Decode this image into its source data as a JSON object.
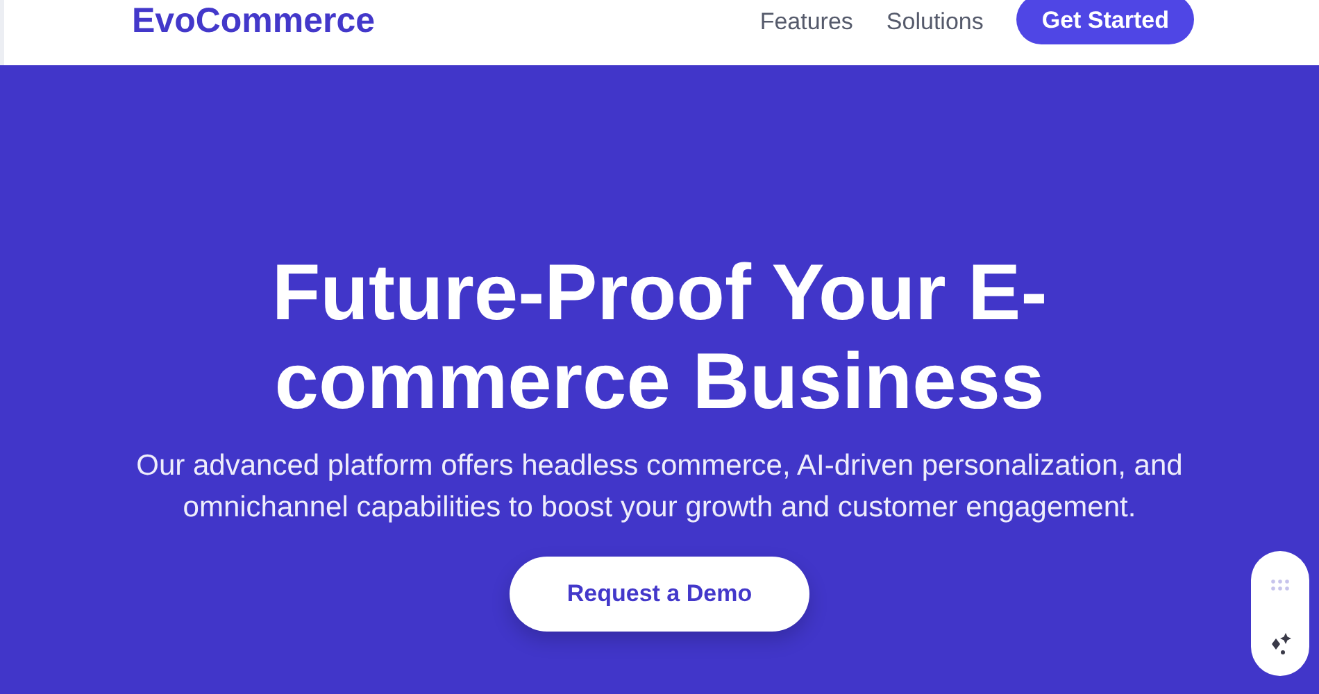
{
  "header": {
    "logo": "EvoCommerce",
    "nav": [
      {
        "label": "Features"
      },
      {
        "label": "Solutions"
      }
    ],
    "cta": "Get Started"
  },
  "hero": {
    "title": "Future-Proof Your E-commerce Business",
    "subtitle": "Our advanced platform offers headless commerce, AI-driven personalization, and omnichannel capabilities to boost your growth and customer engagement.",
    "button": "Request a Demo"
  }
}
